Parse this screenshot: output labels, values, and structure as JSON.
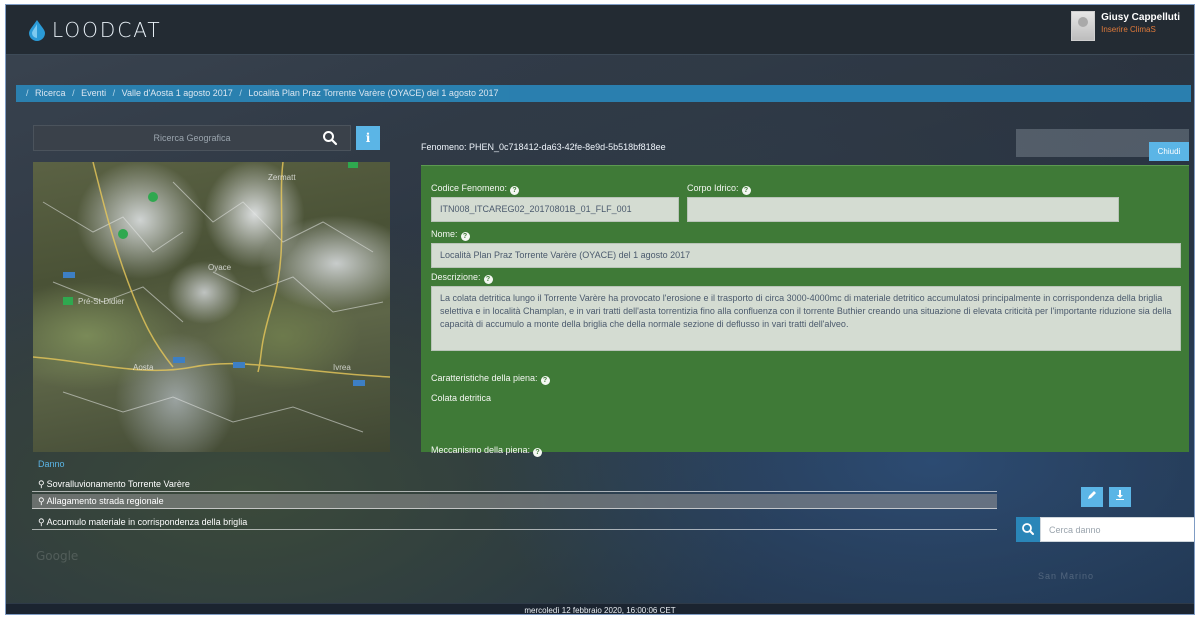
{
  "header": {
    "logo_text": "LOODCAT",
    "user_name": "Giusy Cappelluti",
    "user_role": "Inserire ClimaS"
  },
  "breadcrumb": [
    "Ricerca",
    "Eventi",
    "Valle d'Aosta 1 agosto 2017",
    "Località Plan Praz Torrente Varère (OYACE) del 1 agosto 2017"
  ],
  "geo_search": {
    "placeholder": "Ricerca Geografica"
  },
  "fenomeno": {
    "id_label": "Fenomeno: PHEN_0c718412-da63-42fe-8e9d-5b518bf818ee",
    "close_label": "Chiudi",
    "codice_label": "Codice Fenomeno:",
    "codice_value": "ITN008_ITCAREG02_20170801B_01_FLF_001",
    "corpo_label": "Corpo Idrico:",
    "corpo_value": "",
    "nome_label": "Nome:",
    "nome_value": "Località Plan Praz Torrente Varère (OYACE) del 1 agosto 2017",
    "descrizione_label": "Descrizione:",
    "descrizione_value": "La colata detritica lungo il Torrente Varère ha provocato l'erosione e il trasporto  di circa 3000-4000mc di materiale detritico accumulatosi principalmente in corrispondenza della briglia selettiva e in località Champlan, e in vari tratti dell'asta torrentizia fino alla confluenza con il torrente Buthier creando una situazione di elevata criticità per l'importante riduzione sia della capacità di accumulo a monte della briglia che della normale sezione di deflusso in vari tratti dell'alveo.",
    "caratteristiche_label": "Caratteristiche della piena:",
    "caratteristiche_value": "Colata detritica",
    "meccanismo_label": "Meccanismo della piena:"
  },
  "danno": {
    "title": "Danno",
    "items": [
      "Sovralluvionamento Torrente Varère",
      "Allagamento strada regionale",
      "Accumulo materiale in corrispondenza della briglia"
    ],
    "search_placeholder": "Cerca danno"
  },
  "watermarks": {
    "google": "Google",
    "place": "San Marino"
  },
  "footer": {
    "datetime": "mercoledì 12 febbraio 2020, 16:00:06 CET"
  },
  "colors": {
    "accent": "#5bb5e6",
    "breadcrumb_bg": "#2a86b8",
    "panel_green": "#3f7a37",
    "header_bg": "#232b33"
  },
  "icons": {
    "logo": "water-drop-icon",
    "search": "search-icon",
    "info": "info-icon",
    "help": "question-circle-icon",
    "pin": "map-marker-icon",
    "edit": "pencil-icon",
    "download": "download-icon"
  }
}
